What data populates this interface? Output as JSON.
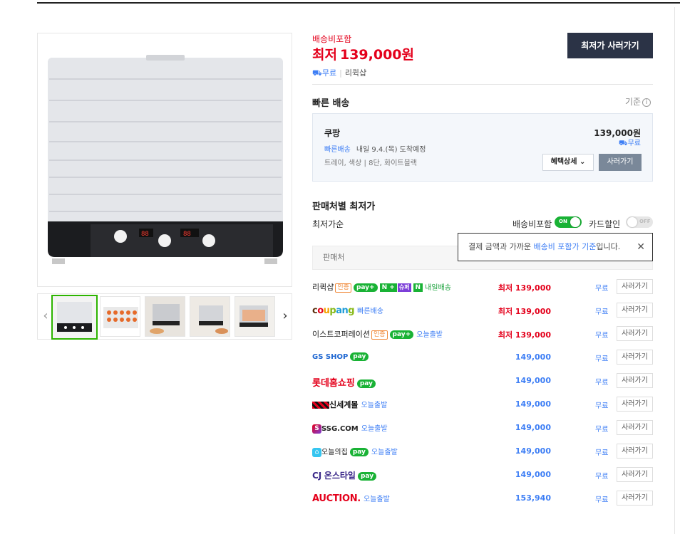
{
  "product": {
    "shipping_included_label": "배송비포함",
    "lowest_label": "최저",
    "lowest_price": "139,000원",
    "free_shipping": "무료",
    "seller_name": "리퀵샵",
    "buy_lowest_button": "최저가 사러가기"
  },
  "fast_delivery": {
    "title": "빠른 배송",
    "criteria": "기준",
    "seller": "쿠팡",
    "price": "139,000원",
    "free": "무료",
    "tag": "빠른배송",
    "eta": "내일 9.4.(목) 도착예정",
    "option": "트레이, 색상 | 8단, 화이트블랙",
    "benefit_button": "혜택상세",
    "buy_button": "사러가기"
  },
  "seller_section": {
    "title": "판매처별 최저가",
    "sort_label": "최저가순",
    "toggle_shipping_label": "배송비포함",
    "toggle_shipping_state": "ON",
    "toggle_card_label": "카드할인",
    "toggle_card_state": "OFF",
    "column_header": "판매처",
    "tooltip_prefix": "결제 금액과 가까운 ",
    "tooltip_highlight": "배송비 포함가 기준",
    "tooltip_suffix": "입니다."
  },
  "badges": {
    "certified": "인증",
    "npay": "pay",
    "npay_plus": "pay+",
    "n_plus": "N +",
    "superpay": "슈퍼",
    "n_letter": "N",
    "tomorrow": "내일배송"
  },
  "sellers": [
    {
      "name": "리퀵샵",
      "tag": "",
      "price": "최저 139,000",
      "ship": "무료",
      "buy": "사러가기"
    },
    {
      "name": "coupang",
      "tag": "빠른배송",
      "price": "최저 139,000",
      "ship": "무료",
      "buy": "사러가기"
    },
    {
      "name": "이스트코퍼레이션",
      "tag": "오늘출발",
      "price": "최저 139,000",
      "ship": "무료",
      "buy": "사러가기"
    },
    {
      "name": "GS SHOP",
      "tag": "",
      "price": "149,000",
      "ship": "무료",
      "buy": "사러가기"
    },
    {
      "name": "롯데홈쇼핑",
      "tag": "",
      "price": "149,000",
      "ship": "무료",
      "buy": "사러가기"
    },
    {
      "name": "신세계몰",
      "tag": "오늘출발",
      "price": "149,000",
      "ship": "무료",
      "buy": "사러가기"
    },
    {
      "name": "SSG.COM",
      "tag": "오늘출발",
      "price": "149,000",
      "ship": "무료",
      "buy": "사러가기"
    },
    {
      "name": "오늘의집",
      "tag": "오늘출발",
      "price": "149,000",
      "ship": "무료",
      "buy": "사러가기"
    },
    {
      "name": "온스타일",
      "tag": "",
      "price": "149,000",
      "ship": "무료",
      "buy": "사러가기"
    },
    {
      "name": "AUCTION.",
      "tag": "오늘출발",
      "price": "153,940",
      "ship": "무료",
      "buy": "사러가기"
    }
  ],
  "product_image": {
    "display_left": "88",
    "display_right": "88"
  },
  "colors": {
    "accent_red": "#e4001b",
    "link_blue": "#3d7ef5",
    "npay_green": "#19b235",
    "dark_button": "#2b3346"
  }
}
